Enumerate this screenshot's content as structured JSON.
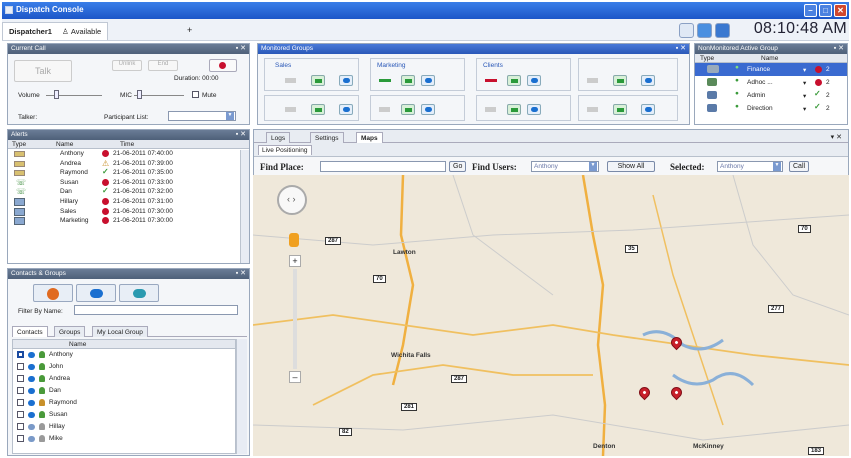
{
  "window": {
    "title": "Dispatch Console"
  },
  "toolbar": {
    "dispatcher_tab": "Dispatcher1",
    "status": "Available",
    "add_tab": "+",
    "clock": "08:10:48 AM"
  },
  "current_call": {
    "header": "Current Call",
    "talk_label": "Talk",
    "unlink_label": "Unlink",
    "end_label": "End",
    "duration_label": "Duration: 00:00",
    "volume_label": "Volume",
    "mic_label": "MIC",
    "mute_label": "Mute",
    "talker_label": "Talker:",
    "participant_label": "Participant List:"
  },
  "monitored_groups": {
    "header": "Monitored Groups",
    "groups": [
      "Sales",
      "Marketing",
      "Clients"
    ]
  },
  "nonmonitored": {
    "header": "NonMonitored Active Group",
    "col_type": "Type",
    "col_name": "Name",
    "rows": [
      {
        "name": "Finance",
        "count": "2",
        "status": "red"
      },
      {
        "name": "Adhoc ...",
        "count": "2",
        "status": "red"
      },
      {
        "name": "Admin",
        "count": "2",
        "status": "green"
      },
      {
        "name": "Direction",
        "count": "2",
        "status": "green"
      }
    ]
  },
  "alerts": {
    "header": "Alerts",
    "col_type": "Type",
    "col_name": "Name",
    "col_time": "Time",
    "rows": [
      {
        "name": "Anthony",
        "time": "21-06-2011 07:40:00",
        "status": "red"
      },
      {
        "name": "Andrea",
        "time": "21-06-2011 07:39:00",
        "status": "warn"
      },
      {
        "name": "Raymond",
        "time": "21-06-2011 07:35:00",
        "status": "green"
      },
      {
        "name": "Susan",
        "time": "21-06-2011 07:33:00",
        "status": "red"
      },
      {
        "name": "Dan",
        "time": "21-06-2011 07:32:00",
        "status": "green"
      },
      {
        "name": "Hillary",
        "time": "21-06-2011 07:31:00",
        "status": "red"
      },
      {
        "name": "Sales",
        "time": "21-06-2011 07:30:00",
        "status": "red"
      },
      {
        "name": "Marketing",
        "time": "21-06-2011 07:30:00",
        "status": "red"
      }
    ]
  },
  "contacts": {
    "header": "Contacts & Groups",
    "filter_label": "Filter By Name:",
    "tabs": [
      "Contacts",
      "Groups",
      "My Local Group"
    ],
    "col_name": "Name",
    "rows": [
      "Anthony",
      "John",
      "Andrea",
      "Dan",
      "Raymond",
      "Susan",
      "Hillay",
      "Mike"
    ]
  },
  "main_tabs": [
    "Logs",
    "Settings",
    "Maps"
  ],
  "maps": {
    "subtab": "Live Positioning",
    "find_place_label": "Find Place:",
    "go_label": "Go",
    "find_users_label": "Find Users:",
    "find_users_value": "Anthony",
    "show_all_label": "Show All",
    "selected_label": "Selected:",
    "selected_value": "Anthony",
    "call_label": "Call",
    "places": [
      "Denton",
      "Wichita Falls",
      "Lawton",
      "McKinney"
    ],
    "highways": [
      "287",
      "281",
      "82",
      "70",
      "35",
      "277",
      "183"
    ]
  },
  "colors": {
    "accent": "#1c56c8",
    "alert_red": "#c8102e",
    "ok_green": "#3a9a3a",
    "pin_red": "#c8202a"
  }
}
